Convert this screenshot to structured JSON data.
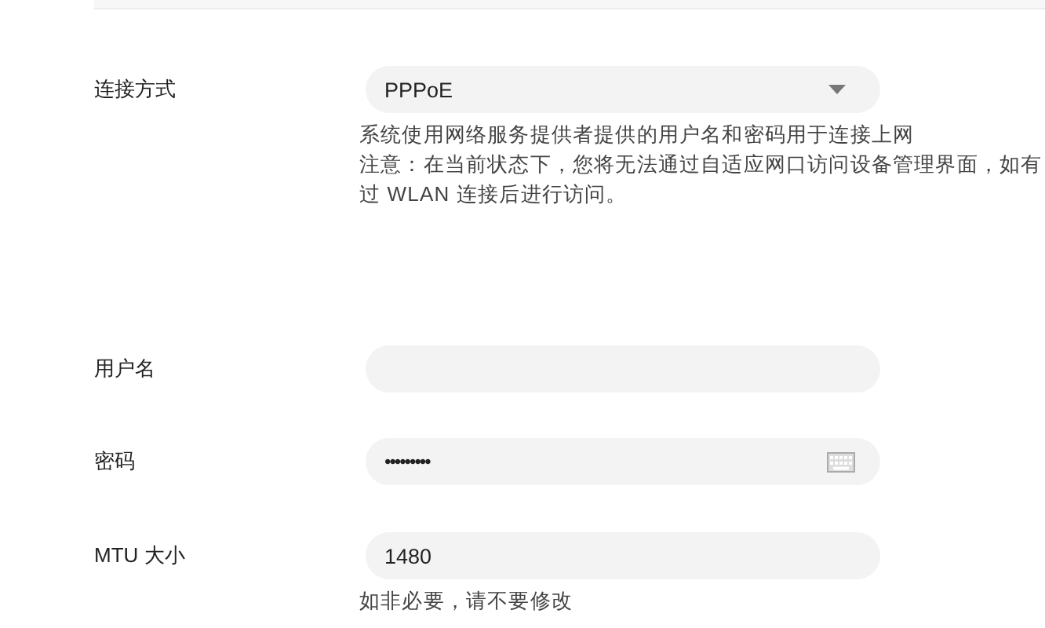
{
  "fields": [
    {
      "kind": "select",
      "label": "连接方式",
      "value": "PPPoE",
      "notes": [
        "系统使用网络服务提供者提供的用户名和密码用于连接上网",
        "注意：在当前状态下，您将无法通过自适应网口访问设备管理界面，如有",
        "过 WLAN 连接后进行访问。"
      ]
    },
    {
      "kind": "text",
      "label": "用户名"
    },
    {
      "kind": "password",
      "label": "密码",
      "value": "•••••••••"
    },
    {
      "kind": "text",
      "label": "MTU 大小",
      "value": "1480",
      "notes": [
        "如非必要，请不要修改"
      ]
    }
  ]
}
